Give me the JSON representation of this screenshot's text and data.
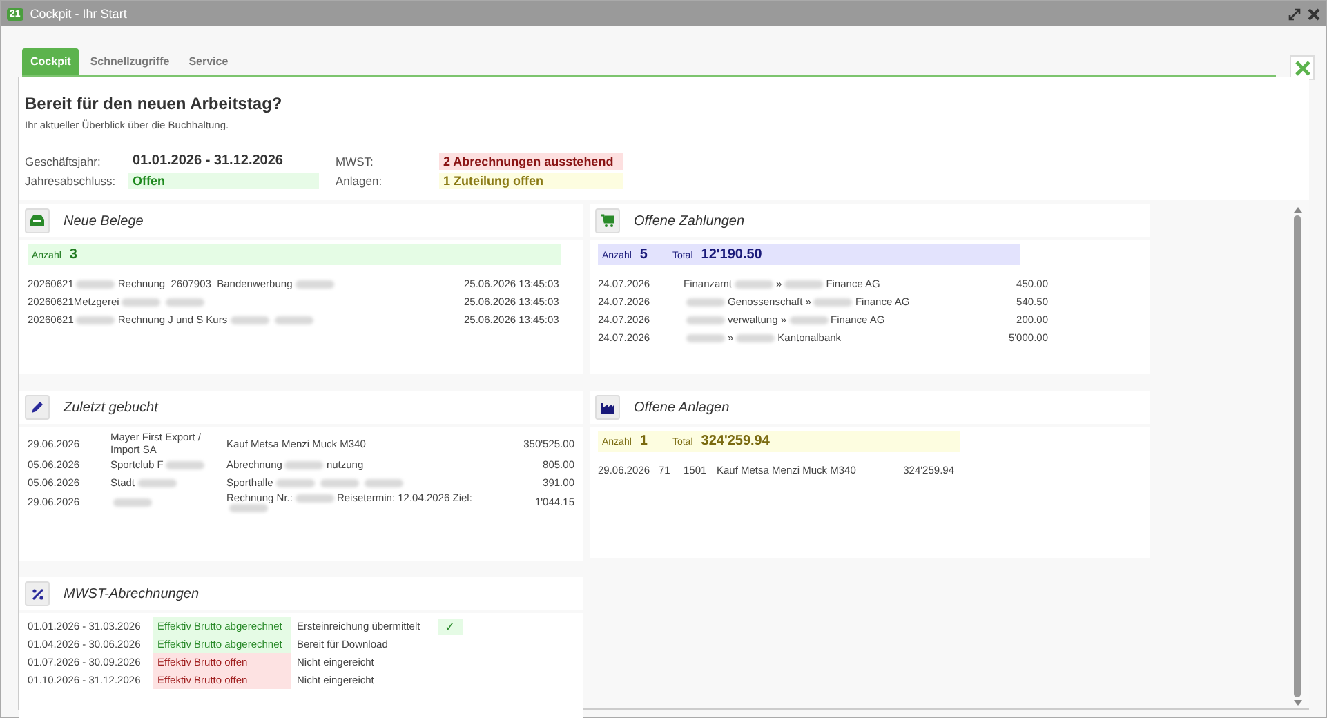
{
  "window": {
    "badge": "21",
    "title": "Cockpit - Ihr Start"
  },
  "tabs": [
    {
      "label": "Cockpit",
      "selected": true
    },
    {
      "label": "Schnellzugriffe",
      "selected": false
    },
    {
      "label": "Service",
      "selected": false
    }
  ],
  "header": {
    "title": "Bereit für den neuen Arbeitstag?",
    "subtitle": "Ihr aktueller Überblick über die Buchhaltung.",
    "fields": [
      {
        "label": "Geschäftsjahr:",
        "value": "01.01.2026 - 31.12.2026",
        "kind": "plain"
      },
      {
        "label": "MWST:",
        "value": "2 Abrechnungen ausstehend",
        "kind": "alert"
      },
      {
        "label": "Jahresabschluss:",
        "value": "Offen",
        "kind": "ok"
      },
      {
        "label": "Anlagen:",
        "value": "1 Zuteilung offen",
        "kind": "pending"
      }
    ]
  },
  "neue_belege": {
    "title": "Neue Belege",
    "summary": {
      "count_label": "Anzahl",
      "count": "3"
    },
    "rows": [
      {
        "parts": [
          {
            "kind": "text",
            "text": "20260621"
          },
          {
            "kind": "redacted"
          },
          {
            "kind": "text",
            "text": "Rechnung_2607903_Bandenwerbung"
          },
          {
            "kind": "redacted"
          }
        ],
        "date": "25.06.2026 13:45:03"
      },
      {
        "parts": [
          {
            "kind": "text",
            "text": "20260621Metzgerei"
          },
          {
            "kind": "redacted"
          },
          {
            "kind": "redacted"
          }
        ],
        "date": "25.06.2026 13:45:03"
      },
      {
        "parts": [
          {
            "kind": "text",
            "text": "20260621"
          },
          {
            "kind": "redacted"
          },
          {
            "kind": "text",
            "text": "Rechnung J und S Kurs"
          },
          {
            "kind": "redacted"
          },
          {
            "kind": "redacted"
          }
        ],
        "date": "25.06.2026 13:45:03"
      }
    ]
  },
  "zuletzt_gebucht": {
    "title": "Zuletzt gebucht",
    "rows": [
      {
        "date": "29.06.2026",
        "partner": [
          {
            "kind": "text",
            "text": "Mayer First Export / Import SA"
          }
        ],
        "text": [
          {
            "kind": "text",
            "text": "Kauf Metsa Menzi Muck M340"
          }
        ],
        "amount": "350'525.00"
      },
      {
        "date": "05.06.2026",
        "partner": [
          {
            "kind": "text",
            "text": "Sportclub F"
          },
          {
            "kind": "redacted"
          }
        ],
        "text": [
          {
            "kind": "text",
            "text": "Abrechnung"
          },
          {
            "kind": "redacted"
          },
          {
            "kind": "text",
            "text": "nutzung"
          }
        ],
        "amount": "805.00"
      },
      {
        "date": "05.06.2026",
        "partner": [
          {
            "kind": "text",
            "text": "Stadt"
          },
          {
            "kind": "redacted"
          }
        ],
        "text": [
          {
            "kind": "text",
            "text": "Sporthalle"
          },
          {
            "kind": "redacted"
          },
          {
            "kind": "redacted"
          },
          {
            "kind": "redacted"
          }
        ],
        "amount": "391.00"
      },
      {
        "date": "29.06.2026",
        "partner": [
          {
            "kind": "redacted"
          }
        ],
        "text": [
          {
            "kind": "text",
            "text": "Rechnung Nr.:"
          },
          {
            "kind": "redacted"
          },
          {
            "kind": "text",
            "text": "Reisetermin: 12.04.2026 Ziel:"
          },
          {
            "kind": "redacted"
          }
        ],
        "amount": "1'044.15"
      }
    ]
  },
  "offene_zahlungen": {
    "title": "Offene Zahlungen",
    "summary": {
      "count_label": "Anzahl",
      "count": "5",
      "total_label": "Total",
      "total": "12'190.50"
    },
    "rows": [
      {
        "date": "24.07.2026",
        "parts": [
          {
            "kind": "text",
            "text": "Finanzamt"
          },
          {
            "kind": "redacted"
          },
          {
            "kind": "text",
            "text": "»"
          },
          {
            "kind": "redacted"
          },
          {
            "kind": "text",
            "text": "Finance AG"
          }
        ],
        "amount": "450.00"
      },
      {
        "date": "24.07.2026",
        "parts": [
          {
            "kind": "redacted"
          },
          {
            "kind": "text",
            "text": "Genossenschaft »"
          },
          {
            "kind": "redacted"
          },
          {
            "kind": "text",
            "text": "Finance AG"
          }
        ],
        "amount": "540.50"
      },
      {
        "date": "24.07.2026",
        "parts": [
          {
            "kind": "redacted"
          },
          {
            "kind": "text",
            "text": "verwaltung »"
          },
          {
            "kind": "redacted"
          },
          {
            "kind": "text",
            "text": "Finance AG"
          }
        ],
        "amount": "200.00"
      },
      {
        "date": "24.07.2026",
        "parts": [
          {
            "kind": "redacted"
          },
          {
            "kind": "text",
            "text": "»"
          },
          {
            "kind": "redacted"
          },
          {
            "kind": "text",
            "text": "Kantonalbank"
          }
        ],
        "amount": "5'000.00"
      }
    ]
  },
  "offene_anlagen": {
    "title": "Offene Anlagen",
    "summary": {
      "count_label": "Anzahl",
      "count": "1",
      "total_label": "Total",
      "total": "324'259.94"
    },
    "rows": [
      {
        "date": "29.06.2026",
        "number": "71",
        "account": "1501",
        "text": "Kauf Metsa Menzi Muck M340",
        "amount": "324'259.94"
      }
    ]
  },
  "mwst": {
    "title": "MWST-Abrechnungen",
    "rows": [
      {
        "period": "01.01.2026 - 31.03.2026",
        "status": "Effektiv Brutto abgerechnet",
        "kind": "done",
        "submission": "Ersteinreichung übermittelt",
        "check": "✓"
      },
      {
        "period": "01.04.2026 - 30.06.2026",
        "status": "Effektiv Brutto abgerechnet",
        "kind": "done",
        "submission": "Bereit für Download"
      },
      {
        "period": "01.07.2026 - 30.09.2026",
        "status": "Effektiv Brutto offen",
        "kind": "open",
        "submission": "Nicht eingereicht"
      },
      {
        "period": "01.10.2026 - 31.12.2026",
        "status": "Effektiv Brutto offen",
        "kind": "open",
        "submission": "Nicht eingereicht"
      }
    ]
  }
}
